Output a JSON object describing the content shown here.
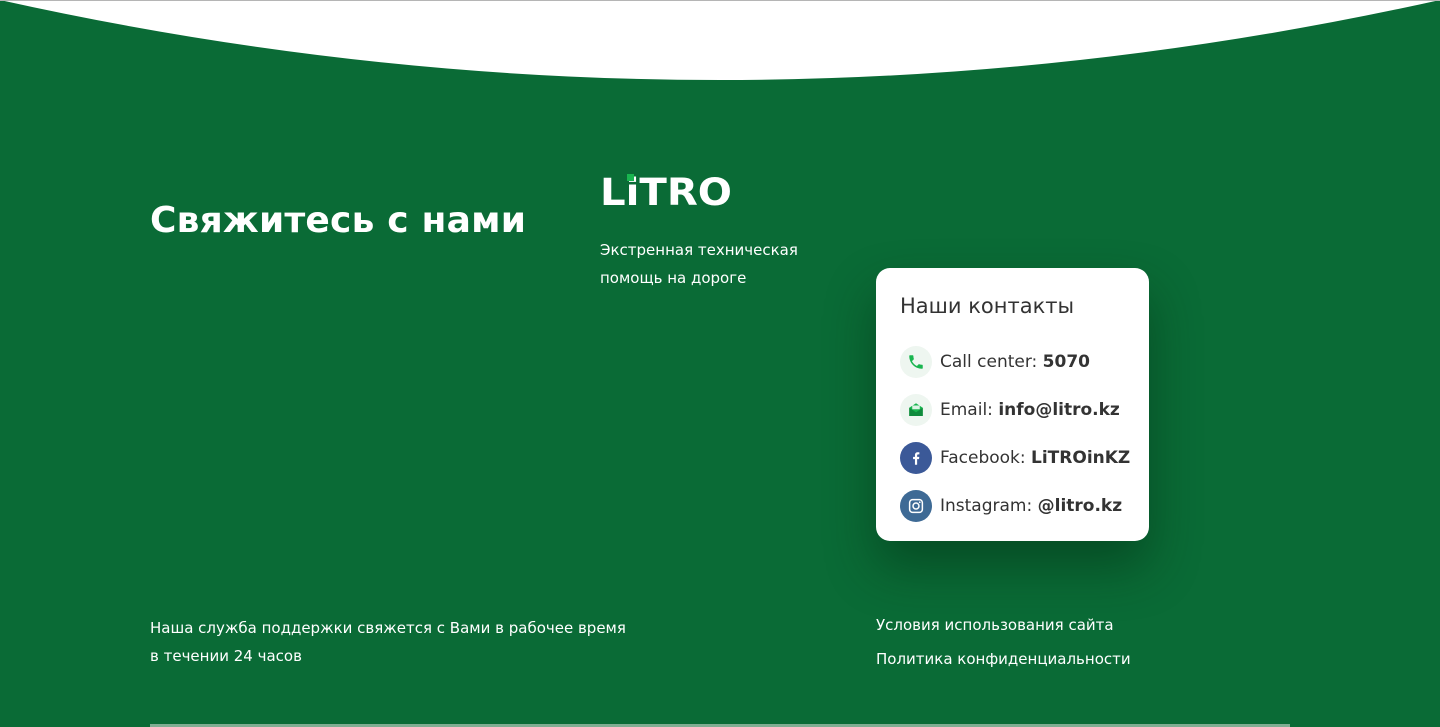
{
  "colors": {
    "background": "#0a6b36",
    "accent": "#19b54f",
    "card_background": "#ffffff",
    "facebook": "#3b5998",
    "instagram": "#3e6a95"
  },
  "logo": {
    "text": "LiTRO"
  },
  "contact_heading": "Свяжитесь с нами",
  "tagline": "Экстренная техническая помощь на дороге",
  "contacts_card": {
    "title": "Наши контакты",
    "items": [
      {
        "icon": "phone-icon",
        "label": "Call center:",
        "value": "5070"
      },
      {
        "icon": "mail-icon",
        "label": "Email:",
        "value": "info@litro.kz"
      },
      {
        "icon": "facebook-icon",
        "label": "Facebook:",
        "value": "LiTROinKZ"
      },
      {
        "icon": "instagram-icon",
        "label": "Instagram:",
        "value": "@litro.kz"
      }
    ]
  },
  "support": {
    "line1": "Наша служба поддержки свяжется с Вами в рабочее время",
    "line2": "в течении 24 часов"
  },
  "footer_links": {
    "terms": "Условия использования сайта",
    "privacy": "Политика конфиденциальности"
  }
}
